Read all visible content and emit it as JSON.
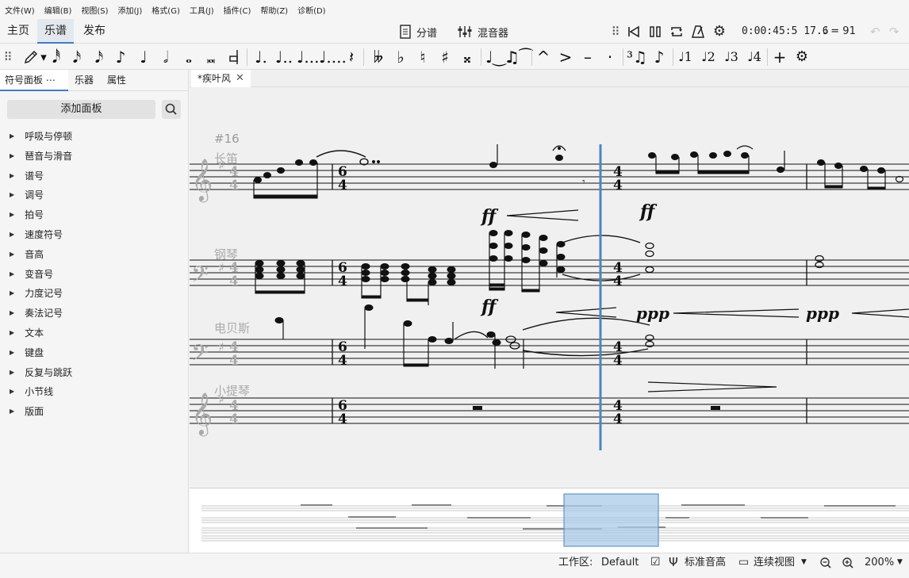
{
  "menu": [
    "文件(W)",
    "编辑(B)",
    "视图(S)",
    "添加(J)",
    "格式(G)",
    "工具(J)",
    "插件(C)",
    "帮助(Z)",
    "诊断(D)"
  ],
  "mode_tabs": [
    "主页",
    "乐谱",
    "发布"
  ],
  "toolbar": {
    "parts_label": "分谱",
    "mixer_label": "混音器",
    "time_display": "0:00:45:5 17.6",
    "tempo_value": "= 91"
  },
  "note_input": {
    "durations": [
      "𝅘𝅥𝅰",
      "𝅘𝅥𝅯",
      "𝅘𝅥𝅮",
      "♪",
      "♩",
      "𝅗𝅥",
      "𝅝",
      "𝅜"
    ],
    "accidentals": [
      "𝄫",
      "♭",
      "♮",
      "♯",
      "𝄪"
    ],
    "articulations": [
      "^",
      ">",
      "–",
      "·"
    ],
    "voices": [
      "1",
      "2",
      "3",
      "4"
    ]
  },
  "left_panel": {
    "tabs": [
      "符号面板 ⋯",
      "乐器",
      "属性"
    ],
    "add_button": "添加面板",
    "palettes": [
      "呼吸与停顿",
      "琶音与滑音",
      "谱号",
      "调号",
      "拍号",
      "速度符号",
      "音高",
      "变音号",
      "力度记号",
      "奏法记号",
      "文本",
      "键盘",
      "反复与跳跃",
      "小节线",
      "版面"
    ]
  },
  "document": {
    "tab_title": "*疾叶风",
    "close": "✕"
  },
  "score": {
    "measure_number": "#16",
    "instruments": [
      "长笛",
      "钢琴",
      "电贝斯",
      "小提琴"
    ],
    "dynamics": [
      "ff",
      "ff",
      "ff",
      "ppp",
      "ppp"
    ],
    "time_signatures": [
      "4/4",
      "6/4",
      "4/4"
    ]
  },
  "status": {
    "workspace_label": "工作区:",
    "workspace_value": "Default",
    "concert_pitch": "标准音高",
    "view_mode": "连续视图",
    "zoom": "200%"
  },
  "colors": {
    "accent": "#3a7bd5",
    "playhead": "#4a86c0",
    "navigator_viewport": "#a9cbe8"
  }
}
